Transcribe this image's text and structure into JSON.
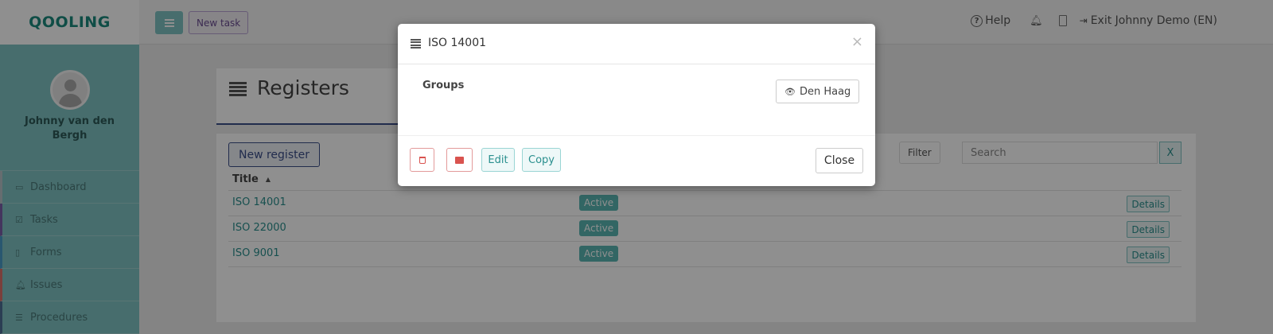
{
  "brand": {
    "logo": "QOOLING"
  },
  "profile": {
    "name": "Johnny van den Bergh"
  },
  "sidebar": {
    "items": [
      {
        "label": "Dashboard",
        "icon": "monitor-icon"
      },
      {
        "label": "Tasks",
        "icon": "checkbox-icon"
      },
      {
        "label": "Forms",
        "icon": "file-icon"
      },
      {
        "label": "Issues",
        "icon": "bell-icon"
      },
      {
        "label": "Procedures",
        "icon": "procedures-icon"
      }
    ]
  },
  "topbar": {
    "new_task": "New task",
    "help": "Help",
    "exit": "Exit Johnny Demo (EN)"
  },
  "page": {
    "title": "Registers",
    "new_register": "New register",
    "filter": "Filter",
    "search_placeholder": "Search",
    "clear": "X",
    "column_title": "Title",
    "rows": [
      {
        "title": "ISO 14001",
        "status": "Active",
        "details": "Details"
      },
      {
        "title": "ISO 22000",
        "status": "Active",
        "details": "Details"
      },
      {
        "title": "ISO 9001",
        "status": "Active",
        "details": "Details"
      }
    ]
  },
  "modal": {
    "title": "ISO 14001",
    "close_x": "×",
    "groups_label": "Groups",
    "group_button": "Den Haag",
    "edit": "Edit",
    "copy": "Copy",
    "close": "Close"
  },
  "colors": {
    "teal": "#7fc3c2",
    "navy": "#3b4f8a",
    "danger": "#d9534f"
  }
}
